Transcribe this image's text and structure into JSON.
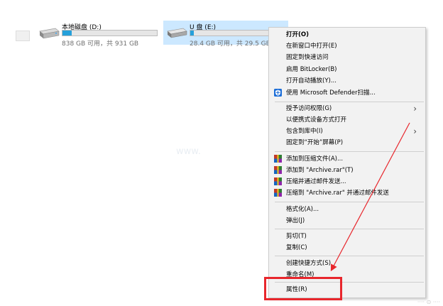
{
  "drives": [
    {
      "name": "本地磁盘 (D:)",
      "size_text": "838 GB 可用，共 931 GB",
      "used_fraction": 0.1
    },
    {
      "name": "U 盘 (E:)",
      "size_text": "28.4 GB 可用，共 29.5 GB",
      "used_fraction": 0.04
    }
  ],
  "context_menu": {
    "items": [
      {
        "label": "打开(O)",
        "bold": true
      },
      {
        "label": "在新窗口中打开(E)"
      },
      {
        "label": "固定到快速访问"
      },
      {
        "label": "启用 BitLocker(B)"
      },
      {
        "label": "打开自动播放(Y)..."
      },
      {
        "label": "使用 Microsoft Defender扫描...",
        "icon": "defender-shield-icon"
      },
      {
        "label": "授予访问权限(G)",
        "submenu": true
      },
      {
        "label": "以便携式设备方式打开"
      },
      {
        "label": "包含到库中(I)",
        "submenu": true
      },
      {
        "label": "固定到“开始”屏幕(P)"
      },
      {
        "label": "添加到压缩文件(A)...",
        "icon": "winrar-icon"
      },
      {
        "label": "添加到 \"Archive.rar\"(T)",
        "icon": "winrar-icon"
      },
      {
        "label": "压缩并通过邮件发送...",
        "icon": "winrar-icon"
      },
      {
        "label": "压缩到 \"Archive.rar\" 并通过邮件发送",
        "icon": "winrar-icon"
      },
      {
        "label": "格式化(A)..."
      },
      {
        "label": "弹出(J)"
      },
      {
        "label": "剪切(T)"
      },
      {
        "label": "复制(C)"
      },
      {
        "label": "创建快捷方式(S)"
      },
      {
        "label": "重命名(M)"
      },
      {
        "label": "属性(R)"
      }
    ]
  },
  "colors": {
    "highlight": "#e8262c",
    "selection": "#cce8ff",
    "bar_fill": "#26a0da"
  },
  "annotation_arrow": {
    "color": "#e8262c",
    "target": "属性(R)"
  }
}
